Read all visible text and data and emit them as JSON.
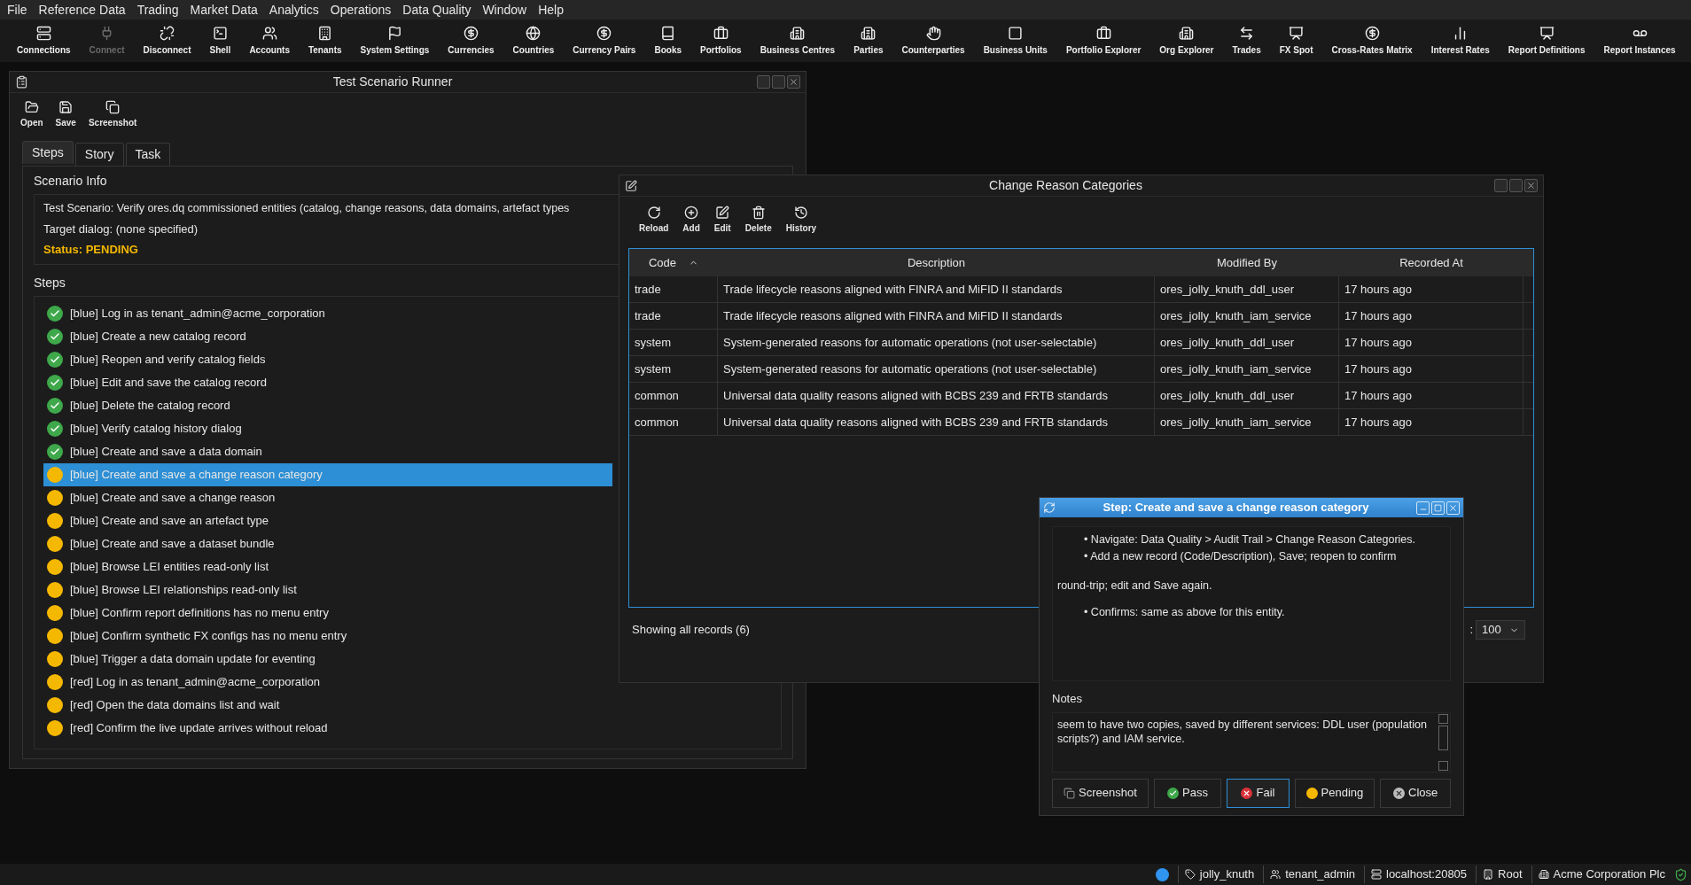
{
  "menu": [
    "File",
    "Reference Data",
    "Trading",
    "Market Data",
    "Analytics",
    "Operations",
    "Data Quality",
    "Window",
    "Help"
  ],
  "toolbar": [
    {
      "label": "Connections",
      "disabled": false
    },
    {
      "label": "Connect",
      "disabled": true
    },
    {
      "label": "Disconnect",
      "disabled": false
    },
    {
      "label": "Shell",
      "disabled": false
    },
    {
      "label": "Accounts",
      "disabled": false
    },
    {
      "label": "Tenants",
      "disabled": false
    },
    {
      "label": "System Settings",
      "disabled": false
    },
    {
      "label": "Currencies",
      "disabled": false
    },
    {
      "label": "Countries",
      "disabled": false
    },
    {
      "label": "Currency Pairs",
      "disabled": false
    },
    {
      "label": "Books",
      "disabled": false
    },
    {
      "label": "Portfolios",
      "disabled": false
    },
    {
      "label": "Business Centres",
      "disabled": false
    },
    {
      "label": "Parties",
      "disabled": false
    },
    {
      "label": "Counterparties",
      "disabled": false
    },
    {
      "label": "Business Units",
      "disabled": false
    },
    {
      "label": "Portfolio Explorer",
      "disabled": false
    },
    {
      "label": "Org Explorer",
      "disabled": false
    },
    {
      "label": "Trades",
      "disabled": false
    },
    {
      "label": "FX Spot",
      "disabled": false
    },
    {
      "label": "Cross-Rates Matrix",
      "disabled": false
    },
    {
      "label": "Interest Rates",
      "disabled": false
    },
    {
      "label": "Report Definitions",
      "disabled": false
    },
    {
      "label": "Report Instances",
      "disabled": false
    }
  ],
  "runner": {
    "title": "Test Scenario Runner",
    "toolbar": [
      "Open",
      "Save",
      "Screenshot"
    ],
    "tabs": [
      {
        "label": "Steps",
        "selected": true
      },
      {
        "label": "Story",
        "selected": false
      },
      {
        "label": "Task",
        "selected": false
      }
    ],
    "info_heading": "Scenario Info",
    "scenario": "Test Scenario: Verify ores.dq commissioned entities (catalog, change reasons, data domains, artefact types",
    "target": "Target dialog: (none specified)",
    "status": "Status: PENDING",
    "steps_heading": "Steps",
    "steps": [
      {
        "label": "[blue] Log in as tenant_admin@acme_corporation",
        "kind": "passed",
        "selected": false
      },
      {
        "label": "[blue] Create a new catalog record",
        "kind": "passed",
        "selected": false
      },
      {
        "label": "[blue] Reopen and verify catalog fields",
        "kind": "passed",
        "selected": false
      },
      {
        "label": "[blue] Edit and save the catalog record",
        "kind": "passed",
        "selected": false
      },
      {
        "label": "[blue] Delete the catalog record",
        "kind": "passed",
        "selected": false
      },
      {
        "label": "[blue] Verify catalog history dialog",
        "kind": "passed",
        "selected": false
      },
      {
        "label": "[blue] Create and save a data domain",
        "kind": "passed",
        "selected": false
      },
      {
        "label": "[blue] Create and save a change reason category",
        "kind": "pending",
        "selected": true
      },
      {
        "label": "[blue] Create and save a change reason",
        "kind": "pending",
        "selected": false
      },
      {
        "label": "[blue] Create and save an artefact type",
        "kind": "pending",
        "selected": false
      },
      {
        "label": "[blue] Create and save a dataset bundle",
        "kind": "pending",
        "selected": false
      },
      {
        "label": "[blue] Browse LEI entities read-only list",
        "kind": "pending",
        "selected": false
      },
      {
        "label": "[blue] Browse LEI relationships read-only list",
        "kind": "pending",
        "selected": false
      },
      {
        "label": "[blue] Confirm report definitions has no menu entry",
        "kind": "pending",
        "selected": false
      },
      {
        "label": "[blue] Confirm synthetic FX configs has no menu entry",
        "kind": "pending",
        "selected": false
      },
      {
        "label": "[blue] Trigger a data domain update for eventing",
        "kind": "pending",
        "selected": false
      },
      {
        "label": "[red] Log in as tenant_admin@acme_corporation",
        "kind": "pending",
        "selected": false
      },
      {
        "label": "[red] Open the data domains list and wait",
        "kind": "pending",
        "selected": false
      },
      {
        "label": "[red] Confirm the live update arrives without reload",
        "kind": "pending",
        "selected": false
      }
    ]
  },
  "categories": {
    "title": "Change Reason Categories",
    "toolbar": [
      "Reload",
      "Add",
      "Edit",
      "Delete",
      "History"
    ],
    "columns": [
      {
        "label": "Code",
        "sorted": true
      },
      {
        "label": "Description",
        "sorted": false
      },
      {
        "label": "Modified By",
        "sorted": false
      },
      {
        "label": "Recorded At",
        "sorted": false
      }
    ],
    "rows": [
      [
        "trade",
        "Trade lifecycle reasons aligned with FINRA and MiFID II standards",
        "ores_jolly_knuth_ddl_user",
        "17 hours ago"
      ],
      [
        "trade",
        "Trade lifecycle reasons aligned with FINRA and MiFID II standards",
        "ores_jolly_knuth_iam_service",
        "17 hours ago"
      ],
      [
        "system",
        "System-generated reasons for automatic operations (not user-selectable)",
        "ores_jolly_knuth_ddl_user",
        "17 hours ago"
      ],
      [
        "system",
        "System-generated reasons for automatic operations (not user-selectable)",
        "ores_jolly_knuth_iam_service",
        "17 hours ago"
      ],
      [
        "common",
        "Universal data quality reasons aligned with BCBS 239 and FRTB standards",
        "ores_jolly_knuth_ddl_user",
        "17 hours ago"
      ],
      [
        "common",
        "Universal data quality reasons aligned with BCBS 239 and FRTB standards",
        "ores_jolly_knuth_iam_service",
        "17 hours ago"
      ]
    ],
    "footer": "Showing all records (6)",
    "page_size_label": ":",
    "page_size": "100"
  },
  "step_dialog": {
    "title": "Step: Create and save a change reason category",
    "instructions": [
      {
        "kind": "bullet",
        "text": "• Navigate: Data Quality > Audit Trail > Change Reason Categories."
      },
      {
        "kind": "bullet_tight",
        "text": "• Add a new record (Code/Description), Save; reopen to confirm"
      },
      {
        "kind": "paragraph",
        "text": "round-trip; edit and Save again."
      },
      {
        "kind": "bullet",
        "text": "• Confirms: same as above for this entity."
      }
    ],
    "notes_label": "Notes",
    "notes": "seem to have two copies, saved by different services: DDL user (population scripts?) and IAM service.",
    "buttons": [
      {
        "label": "Screenshot",
        "kind": "screenshot",
        "selected": false
      },
      {
        "label": "Pass",
        "kind": "pass",
        "selected": false
      },
      {
        "label": "Fail",
        "kind": "fail",
        "selected": true
      },
      {
        "label": "Pending",
        "kind": "pending",
        "selected": false
      },
      {
        "label": "Close",
        "kind": "close",
        "selected": false
      }
    ]
  },
  "status_bar": [
    "jolly_knuth",
    "tenant_admin",
    "localhost:20805",
    "Root",
    "Acme Corporation Plc"
  ]
}
